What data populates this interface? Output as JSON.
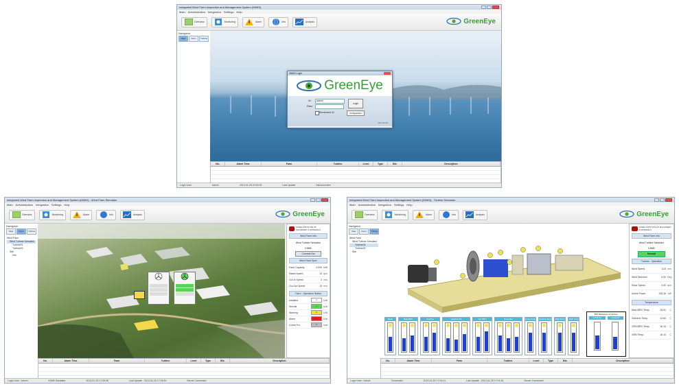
{
  "login_screen": {
    "window_title": "Integrated Wind Farm Inspection and Management System (IWMS)",
    "menu": [
      "Main",
      "Administration",
      "Integration",
      "Settings",
      "Help"
    ],
    "toolbar": [
      "Overview",
      "Monitoring",
      "Alarm",
      "Info",
      "Analysis"
    ],
    "brand": "GreenEye",
    "nav_title": "Navigator",
    "nav_buttons": [
      "View",
      "Farm",
      "Turbine"
    ],
    "dialog": {
      "title": "IWMS Login",
      "brand": "GreenEye",
      "id_label": "ID:",
      "id_value": "Admin",
      "pw_label": "Pass:",
      "login_button": "Login",
      "remember_label": "Remember ID",
      "config_button": "Configuration",
      "version": "Ver 1.0.0.0"
    },
    "alarm_headers": [
      "No.",
      "Alarm Time",
      "Farm",
      "Turbine",
      "Level",
      "Type",
      "Bin",
      "Description"
    ],
    "status": [
      "Login User",
      "Admin",
      "2013-01-25 10:00:00",
      "Last Update",
      "Disconnected"
    ]
  },
  "farm_screen": {
    "window_title": "Integrated Wind Farm Inspection and Management System (IWMS) - Wind Farm Simulator",
    "toolbar": [
      "Overview",
      "Monitoring",
      "Alarm",
      "Info",
      "Analysis"
    ],
    "brand": "GreenEye",
    "nav_buttons": [
      "View",
      "Farm",
      "Turbine"
    ],
    "tree": [
      "Wind Farm",
      "Wind Turbine Simulator",
      "Turbine01",
      "Turbine02",
      "Site",
      "Info"
    ],
    "institute": "KOREA INSTITUTE OF MACHINERY & MATERIALS",
    "farm_info_header": "Wind Farm Info",
    "farm_name": "Wind Turbine Simulator",
    "farm_id": "KIMM",
    "connect_button": "Connect Ext",
    "spec_header": "Wind Farm Spec",
    "specs": [
      {
        "label": "Farm Capacity",
        "value": "0.005",
        "unit": "MW"
      },
      {
        "label": "Rated Speed",
        "value": "13",
        "unit": "rpm"
      },
      {
        "label": "Cut-In Speed",
        "value": "3",
        "unit": "m/s"
      },
      {
        "label": "Cut-Out Speed",
        "value": "13",
        "unit": "m/s"
      }
    ],
    "ops_header": "Farm - Operation Status",
    "ops": [
      {
        "label": "Installed",
        "value": "2",
        "unit": "Unit",
        "color": "#ffffff"
      },
      {
        "label": "Normal",
        "value": "1",
        "unit": "Unit",
        "color": "#5bd35b"
      },
      {
        "label": "Warning",
        "value": "0",
        "unit": "Unit",
        "color": "#f0e030"
      },
      {
        "label": "Alarm",
        "value": "1",
        "unit": "Unit",
        "color": "#e02020"
      },
      {
        "label": "Comm Err.",
        "value": "0",
        "unit": "Unit",
        "color": "#bbbbbb"
      }
    ],
    "alarm_headers": [
      "No.",
      "Alarm Time",
      "Farm",
      "Turbine",
      "Level",
      "Type",
      "Bin",
      "Description"
    ],
    "status": [
      "Login User : Admin",
      "KIMM Simulator",
      "2013-01-25 17:05:35",
      "Last Update : 2013-01-25 17:05:30",
      "Server Connected"
    ]
  },
  "turbine_screen": {
    "window_title": "Integrated Wind Farm Inspection and Management System (IWMS) - Turbine Simulator",
    "toolbar": [
      "Overview",
      "Monitoring",
      "Alarm",
      "Info",
      "Analysis"
    ],
    "brand": "GreenEye",
    "nav_buttons": [
      "View",
      "Farm",
      "Turbine"
    ],
    "tree": [
      "Wind Farm",
      "Wind Turbine Simulator",
      "Turbine01",
      "Turbine02",
      "Site"
    ],
    "institute": "KOREA INSTITUTE OF MACHINERY & MATERIALS",
    "info_header": "Wind Farm Info",
    "farm_name": "Wind Turbine Simulator",
    "turbine_id": "KIMM",
    "status_value": "Normal",
    "op_header": "Turbine - Operation",
    "op": [
      {
        "label": "Wind Speed",
        "value": "11.8",
        "unit": "m/s"
      },
      {
        "label": "Wind Direction",
        "value": "0.00",
        "unit": "Deg"
      },
      {
        "label": "Rotor Speed",
        "value": "0.00",
        "unit": "rpm"
      },
      {
        "label": "Active Power",
        "value": "145.16",
        "unit": "kW"
      }
    ],
    "temp_header": "Temperature",
    "temps": [
      {
        "label": "Main BRG Temp.",
        "value": "18.51",
        "unit": "C"
      },
      {
        "label": "Gearbox Temp.",
        "value": "13.63",
        "unit": "C"
      },
      {
        "label": "GEN BRG Temp.",
        "value": "16.13",
        "unit": "C"
      },
      {
        "label": "GEN Temp.",
        "value": "16.13",
        "unit": "C"
      }
    ],
    "gauge_groups": [
      {
        "label": "Blade",
        "levels": [
          0.55
        ]
      },
      {
        "label": "Main BRG",
        "levels": [
          0.5,
          0.6
        ]
      },
      {
        "label": "Gearbox",
        "levels": [
          0.55,
          0.7
        ]
      },
      {
        "label": "Gearbox HS",
        "levels": [
          0.5,
          0.45,
          0.65
        ]
      },
      {
        "label": "Gen BRG",
        "levels": [
          0.55,
          0.75
        ]
      },
      {
        "label": "Generator",
        "levels": [
          0.6,
          0.5,
          0.55
        ]
      },
      {
        "label": "Rotor Temp",
        "levels": [
          0.7
        ]
      },
      {
        "label": "Gearbox Temp",
        "levels": [
          0.72
        ]
      },
      {
        "label": "BRG Temp",
        "levels": [
          0.7
        ]
      },
      {
        "label": "GEN Temp",
        "levels": [
          0.72
        ]
      }
    ],
    "bds_title": "Bolt Management System",
    "bds": [
      {
        "label": "Location1",
        "level": 0.55
      },
      {
        "label": "Location2",
        "level": 0.5
      }
    ],
    "alarm_headers": [
      "No.",
      "Alarm Time",
      "Farm",
      "Turbine",
      "Level",
      "Type",
      "Bin",
      "Description"
    ],
    "status": [
      "Login User : Admin",
      "Connected",
      "2013-01-25 17:04:41",
      "Last Update : 2013-01-25 17:04:36",
      "Server Connected"
    ]
  },
  "colors": {
    "accent": "#3a9a3a",
    "sea": "#4f86b3",
    "sky": "#d8e6f1",
    "gauge": "#1f3fd0"
  }
}
